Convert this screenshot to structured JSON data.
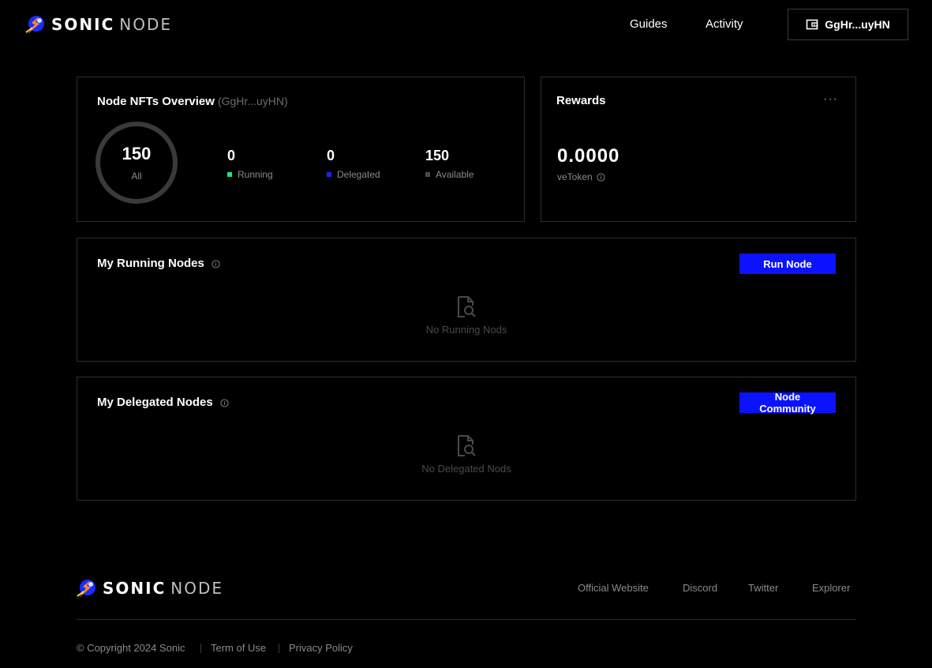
{
  "brand": {
    "word1": "SONIC",
    "word2": "NODE"
  },
  "header": {
    "nav": [
      "Guides",
      "Activity"
    ],
    "wallet_label": "GgHr...uyHN"
  },
  "overview": {
    "title": "Node NFTs Overview",
    "address": "(GgHr...uyHN)",
    "total": {
      "value": "150",
      "label": "All"
    },
    "stats": [
      {
        "value": "0",
        "label": "Running",
        "color": "#22e07a"
      },
      {
        "value": "0",
        "label": "Delegated",
        "color": "#1a22ff"
      },
      {
        "value": "150",
        "label": "Available",
        "color": "#4a4a4a"
      }
    ]
  },
  "rewards": {
    "title": "Rewards",
    "menu": "···",
    "value": "0.0000",
    "unit": "veToken"
  },
  "running_nodes": {
    "title": "My Running Nodes",
    "button": "Run Node",
    "empty": "No Running Nods"
  },
  "delegated_nodes": {
    "title": "My Delegated Nodes",
    "button": "Node Community",
    "empty": "No Delegated Nods"
  },
  "footer": {
    "links": [
      "Official Website",
      "Discord",
      "Twitter",
      "Explorer"
    ],
    "copyright": "© Copyright 2024 Sonic",
    "legal": [
      "Term of Use",
      "Privacy Policy"
    ]
  },
  "colors": {
    "accent": "#0b12ff",
    "background": "#000000",
    "border": "#2e2e2e",
    "muted": "#8a8a8a"
  }
}
